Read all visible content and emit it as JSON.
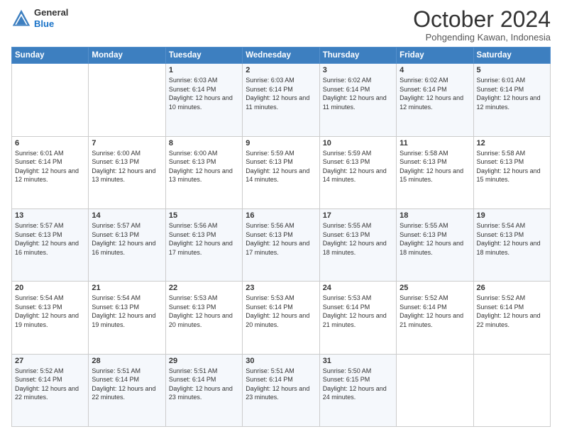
{
  "header": {
    "logo_line1": "General",
    "logo_line2": "Blue",
    "month": "October 2024",
    "location": "Pohgending Kawan, Indonesia"
  },
  "weekdays": [
    "Sunday",
    "Monday",
    "Tuesday",
    "Wednesday",
    "Thursday",
    "Friday",
    "Saturday"
  ],
  "weeks": [
    [
      {
        "day": "",
        "sunrise": "",
        "sunset": "",
        "daylight": ""
      },
      {
        "day": "",
        "sunrise": "",
        "sunset": "",
        "daylight": ""
      },
      {
        "day": "1",
        "sunrise": "Sunrise: 6:03 AM",
        "sunset": "Sunset: 6:14 PM",
        "daylight": "Daylight: 12 hours and 10 minutes."
      },
      {
        "day": "2",
        "sunrise": "Sunrise: 6:03 AM",
        "sunset": "Sunset: 6:14 PM",
        "daylight": "Daylight: 12 hours and 11 minutes."
      },
      {
        "day": "3",
        "sunrise": "Sunrise: 6:02 AM",
        "sunset": "Sunset: 6:14 PM",
        "daylight": "Daylight: 12 hours and 11 minutes."
      },
      {
        "day": "4",
        "sunrise": "Sunrise: 6:02 AM",
        "sunset": "Sunset: 6:14 PM",
        "daylight": "Daylight: 12 hours and 12 minutes."
      },
      {
        "day": "5",
        "sunrise": "Sunrise: 6:01 AM",
        "sunset": "Sunset: 6:14 PM",
        "daylight": "Daylight: 12 hours and 12 minutes."
      }
    ],
    [
      {
        "day": "6",
        "sunrise": "Sunrise: 6:01 AM",
        "sunset": "Sunset: 6:14 PM",
        "daylight": "Daylight: 12 hours and 12 minutes."
      },
      {
        "day": "7",
        "sunrise": "Sunrise: 6:00 AM",
        "sunset": "Sunset: 6:13 PM",
        "daylight": "Daylight: 12 hours and 13 minutes."
      },
      {
        "day": "8",
        "sunrise": "Sunrise: 6:00 AM",
        "sunset": "Sunset: 6:13 PM",
        "daylight": "Daylight: 12 hours and 13 minutes."
      },
      {
        "day": "9",
        "sunrise": "Sunrise: 5:59 AM",
        "sunset": "Sunset: 6:13 PM",
        "daylight": "Daylight: 12 hours and 14 minutes."
      },
      {
        "day": "10",
        "sunrise": "Sunrise: 5:59 AM",
        "sunset": "Sunset: 6:13 PM",
        "daylight": "Daylight: 12 hours and 14 minutes."
      },
      {
        "day": "11",
        "sunrise": "Sunrise: 5:58 AM",
        "sunset": "Sunset: 6:13 PM",
        "daylight": "Daylight: 12 hours and 15 minutes."
      },
      {
        "day": "12",
        "sunrise": "Sunrise: 5:58 AM",
        "sunset": "Sunset: 6:13 PM",
        "daylight": "Daylight: 12 hours and 15 minutes."
      }
    ],
    [
      {
        "day": "13",
        "sunrise": "Sunrise: 5:57 AM",
        "sunset": "Sunset: 6:13 PM",
        "daylight": "Daylight: 12 hours and 16 minutes."
      },
      {
        "day": "14",
        "sunrise": "Sunrise: 5:57 AM",
        "sunset": "Sunset: 6:13 PM",
        "daylight": "Daylight: 12 hours and 16 minutes."
      },
      {
        "day": "15",
        "sunrise": "Sunrise: 5:56 AM",
        "sunset": "Sunset: 6:13 PM",
        "daylight": "Daylight: 12 hours and 17 minutes."
      },
      {
        "day": "16",
        "sunrise": "Sunrise: 5:56 AM",
        "sunset": "Sunset: 6:13 PM",
        "daylight": "Daylight: 12 hours and 17 minutes."
      },
      {
        "day": "17",
        "sunrise": "Sunrise: 5:55 AM",
        "sunset": "Sunset: 6:13 PM",
        "daylight": "Daylight: 12 hours and 18 minutes."
      },
      {
        "day": "18",
        "sunrise": "Sunrise: 5:55 AM",
        "sunset": "Sunset: 6:13 PM",
        "daylight": "Daylight: 12 hours and 18 minutes."
      },
      {
        "day": "19",
        "sunrise": "Sunrise: 5:54 AM",
        "sunset": "Sunset: 6:13 PM",
        "daylight": "Daylight: 12 hours and 18 minutes."
      }
    ],
    [
      {
        "day": "20",
        "sunrise": "Sunrise: 5:54 AM",
        "sunset": "Sunset: 6:13 PM",
        "daylight": "Daylight: 12 hours and 19 minutes."
      },
      {
        "day": "21",
        "sunrise": "Sunrise: 5:54 AM",
        "sunset": "Sunset: 6:13 PM",
        "daylight": "Daylight: 12 hours and 19 minutes."
      },
      {
        "day": "22",
        "sunrise": "Sunrise: 5:53 AM",
        "sunset": "Sunset: 6:13 PM",
        "daylight": "Daylight: 12 hours and 20 minutes."
      },
      {
        "day": "23",
        "sunrise": "Sunrise: 5:53 AM",
        "sunset": "Sunset: 6:14 PM",
        "daylight": "Daylight: 12 hours and 20 minutes."
      },
      {
        "day": "24",
        "sunrise": "Sunrise: 5:53 AM",
        "sunset": "Sunset: 6:14 PM",
        "daylight": "Daylight: 12 hours and 21 minutes."
      },
      {
        "day": "25",
        "sunrise": "Sunrise: 5:52 AM",
        "sunset": "Sunset: 6:14 PM",
        "daylight": "Daylight: 12 hours and 21 minutes."
      },
      {
        "day": "26",
        "sunrise": "Sunrise: 5:52 AM",
        "sunset": "Sunset: 6:14 PM",
        "daylight": "Daylight: 12 hours and 22 minutes."
      }
    ],
    [
      {
        "day": "27",
        "sunrise": "Sunrise: 5:52 AM",
        "sunset": "Sunset: 6:14 PM",
        "daylight": "Daylight: 12 hours and 22 minutes."
      },
      {
        "day": "28",
        "sunrise": "Sunrise: 5:51 AM",
        "sunset": "Sunset: 6:14 PM",
        "daylight": "Daylight: 12 hours and 22 minutes."
      },
      {
        "day": "29",
        "sunrise": "Sunrise: 5:51 AM",
        "sunset": "Sunset: 6:14 PM",
        "daylight": "Daylight: 12 hours and 23 minutes."
      },
      {
        "day": "30",
        "sunrise": "Sunrise: 5:51 AM",
        "sunset": "Sunset: 6:14 PM",
        "daylight": "Daylight: 12 hours and 23 minutes."
      },
      {
        "day": "31",
        "sunrise": "Sunrise: 5:50 AM",
        "sunset": "Sunset: 6:15 PM",
        "daylight": "Daylight: 12 hours and 24 minutes."
      },
      {
        "day": "",
        "sunrise": "",
        "sunset": "",
        "daylight": ""
      },
      {
        "day": "",
        "sunrise": "",
        "sunset": "",
        "daylight": ""
      }
    ]
  ]
}
